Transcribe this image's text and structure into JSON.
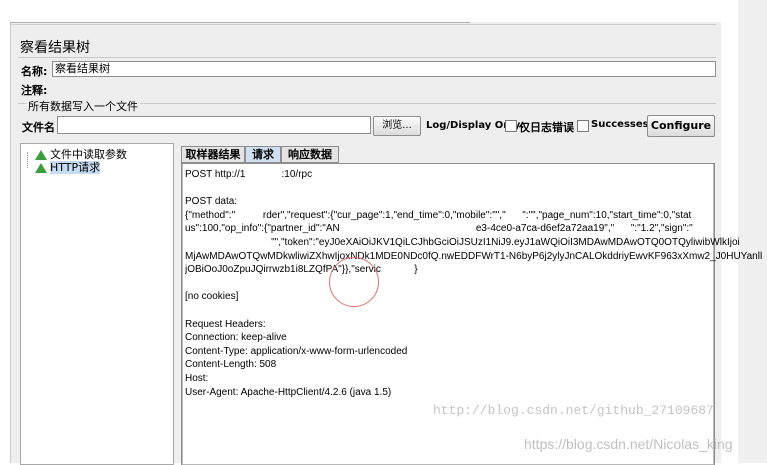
{
  "panel": {
    "title": "察看结果树"
  },
  "fields": {
    "name_label": "名称:",
    "name_value": "察看结果树",
    "comment_label": "注释:"
  },
  "file_group": {
    "title": "所有数据写入一个文件",
    "filename_label": "文件名",
    "filename_value": "",
    "browse_label": "浏览...",
    "log_display_label": "Log/Display Only:",
    "errors_label": "仅日志错误",
    "successes_label": "Successes",
    "configure_label": "Configure"
  },
  "tree": {
    "items": [
      {
        "label": "文件中读取参数",
        "selected": false
      },
      {
        "label": "HTTP请求",
        "selected": true
      }
    ]
  },
  "tabs": [
    {
      "label": "取样器结果",
      "active": false
    },
    {
      "label": "请求",
      "active": true
    },
    {
      "label": "响应数据",
      "active": false
    }
  ],
  "request": {
    "lines": [
      "POST http://1             :10/rpc",
      "",
      "POST data:",
      "{\"method\":\"          rder\",\"request\":{\"cur_page\":1,\"end_time\":0,\"mobile\":\"\",\"      \":\"\",\"page_num\":10,\"start_time\":0,\"stat",
      "us\":100,\"op_info\":{\"partner_id\":\"AN                                                 e3-4ce0-a7ca-d6ef2a72aa19\",\"      \":\"1.2\",\"sign\":\"",
      "                               \"\",\"token\":\"eyJ0eXAiOiJKV1QiLCJhbGciOiJSUzI1NiJ9.eyJ1aWQiOiI3MDAwMDAwOTQ0OTQyliwibWlkIjoi",
      "MjAwMDAwOTQwMDkwliwiZXhwIjoxNDk1MDE0NDc0fQ.nwEDDFWrT1-N6byP6j2ylyJnCALOkddriyEwvKF963xXmw2_J0HUYanll",
      "jOBiOoJ0oZpuJQirrwzb1i8LZQfPA\"}},\"servic            }",
      "",
      "[no cookies]",
      "",
      "Request Headers:",
      "Connection: keep-alive",
      "Content-Type: application/x-www-form-urlencoded",
      "Content-Length: 508",
      "Host:                             ",
      "User-Agent: Apache-HttpClient/4.2.6 (java 1.5)"
    ]
  },
  "watermarks": {
    "blog1": "http://blog.csdn.net/github_27109687",
    "blog2": "https://blog.csdn.net/Nicolas_king"
  }
}
